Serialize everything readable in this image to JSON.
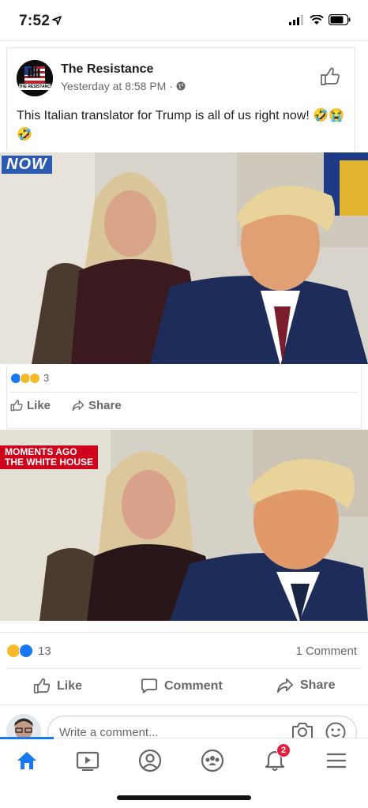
{
  "status_bar": {
    "time": "7:52"
  },
  "post": {
    "page_name": "The Resistance",
    "avatar_text": "THE RESISTANCE",
    "meta": "Yesterday at 8:58 PM ·",
    "text": "This Italian translator for Trump is all of us right now! 🤣😭🤣"
  },
  "photo1": {
    "banner": "NOW"
  },
  "photo2": {
    "banner_line1": "MOMENTS AGO",
    "banner_line2": "THE WHITE HOUSE"
  },
  "inner_stats": {
    "reaction_count": "3",
    "like_label": "Like",
    "share_label": "Share"
  },
  "main_stats": {
    "reaction_count": "13",
    "comment_count": "1 Comment"
  },
  "actions": {
    "like": "Like",
    "comment": "Comment",
    "share": "Share"
  },
  "comment_box": {
    "placeholder": "Write a comment..."
  },
  "tab_bar": {
    "notification_badge": "2"
  },
  "colors": {
    "accent": "#1877f2",
    "badge": "#e41e3f",
    "banner_red": "#d0021b"
  }
}
